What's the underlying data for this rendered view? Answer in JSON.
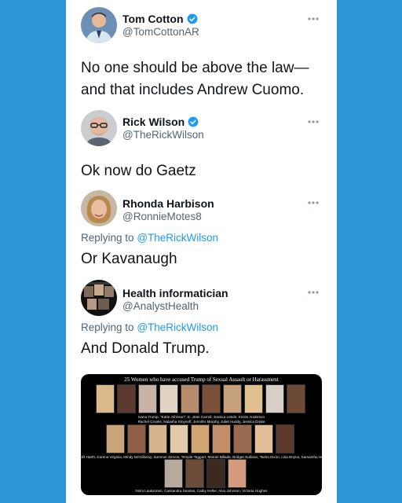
{
  "tweets": [
    {
      "name": "Tom Cotton",
      "handle": "@TomCottonAR",
      "verified": true,
      "text_lines": [
        "No one should be above the law—",
        "and that includes Andrew Cuomo."
      ]
    },
    {
      "name": "Rick Wilson",
      "handle": "@TheRickWilson",
      "verified": true,
      "text_lines": [
        "Ok now do Gaetz"
      ]
    },
    {
      "name": "Rhonda Harbison",
      "handle": "@RonnieMotes8",
      "verified": false,
      "replying_prefix": "Replying to",
      "replying_to": "@TheRickWilson",
      "text_lines": [
        "Or Kavanaugh"
      ]
    },
    {
      "name": "Health informatician",
      "handle": "@AnalystHealth",
      "verified": false,
      "replying_prefix": "Replying to",
      "replying_to": "@TheRickWilson",
      "text_lines": [
        "And Donald Trump."
      ]
    }
  ],
  "media": {
    "title": "25 Women who have accused Trump of Sexual Assault or Harassment",
    "caption_lines": [
      "Ivana Trump, \"Katie Johnson\", E. Jean Carroll, Jessica Leeds, Kristin Anderson",
      "Rachel Crooks, Natasha Stoynoff, Jennifer Murphy, Juliet Huddy, Jessica Drake",
      "Jill Harth, Karena Virginia, Mindy McGillivray, Summer Zervos, Temple Taggart, Mariah Billado, Bridget Sullivan, Tasha Dixon, Lisa Boyne, Samantha Holvey",
      "Ninni Laaksonen, Cassandra Searles, Cathy Heller, Alva Johnson, Victoria Hughes"
    ]
  },
  "colors": {
    "page_background": "#2d97d6",
    "card_background": "#ffffff",
    "text": "#0f1419",
    "secondary_text": "#536471",
    "link": "#1d9bf0",
    "verified_badge": "#1d9bf0"
  },
  "icons": {
    "verified": "verified-badge-icon",
    "more": "more-options-icon"
  }
}
